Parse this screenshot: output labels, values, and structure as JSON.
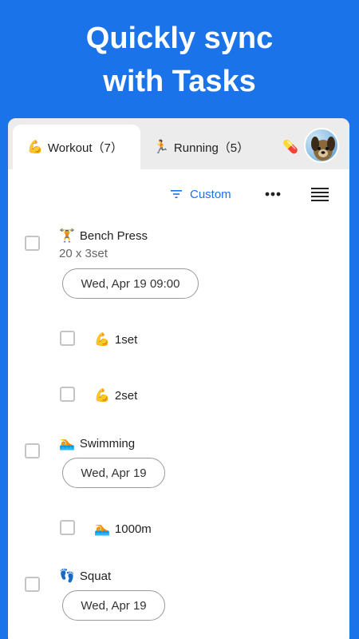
{
  "headline": {
    "line1": "Quickly sync",
    "line2": "with Tasks"
  },
  "tabs": [
    {
      "emoji": "💪",
      "label": "Workout（7）"
    },
    {
      "emoji": "🏃",
      "label": "Running（5）"
    },
    {
      "emoji": "💊",
      "label": ""
    }
  ],
  "toolbar": {
    "filter_label": "Custom",
    "more_label": "•••"
  },
  "tasks": [
    {
      "emoji": "🏋",
      "title": "Bench Press",
      "subtitle": "20 x 3set",
      "date": "Wed, Apr 19 09:00"
    },
    {
      "emoji": "💪",
      "title": "1set"
    },
    {
      "emoji": "💪",
      "title": "2set"
    },
    {
      "emoji": "🏊",
      "title": "Swimming",
      "date": "Wed, Apr 19"
    },
    {
      "emoji": "🏊",
      "title": "1000m"
    },
    {
      "emoji": "👣",
      "title": "Squat",
      "date": "Wed, Apr 19"
    }
  ],
  "colors": {
    "brand": "#1a73e8",
    "tabbar": "#ececec",
    "card": "#ffffff"
  }
}
